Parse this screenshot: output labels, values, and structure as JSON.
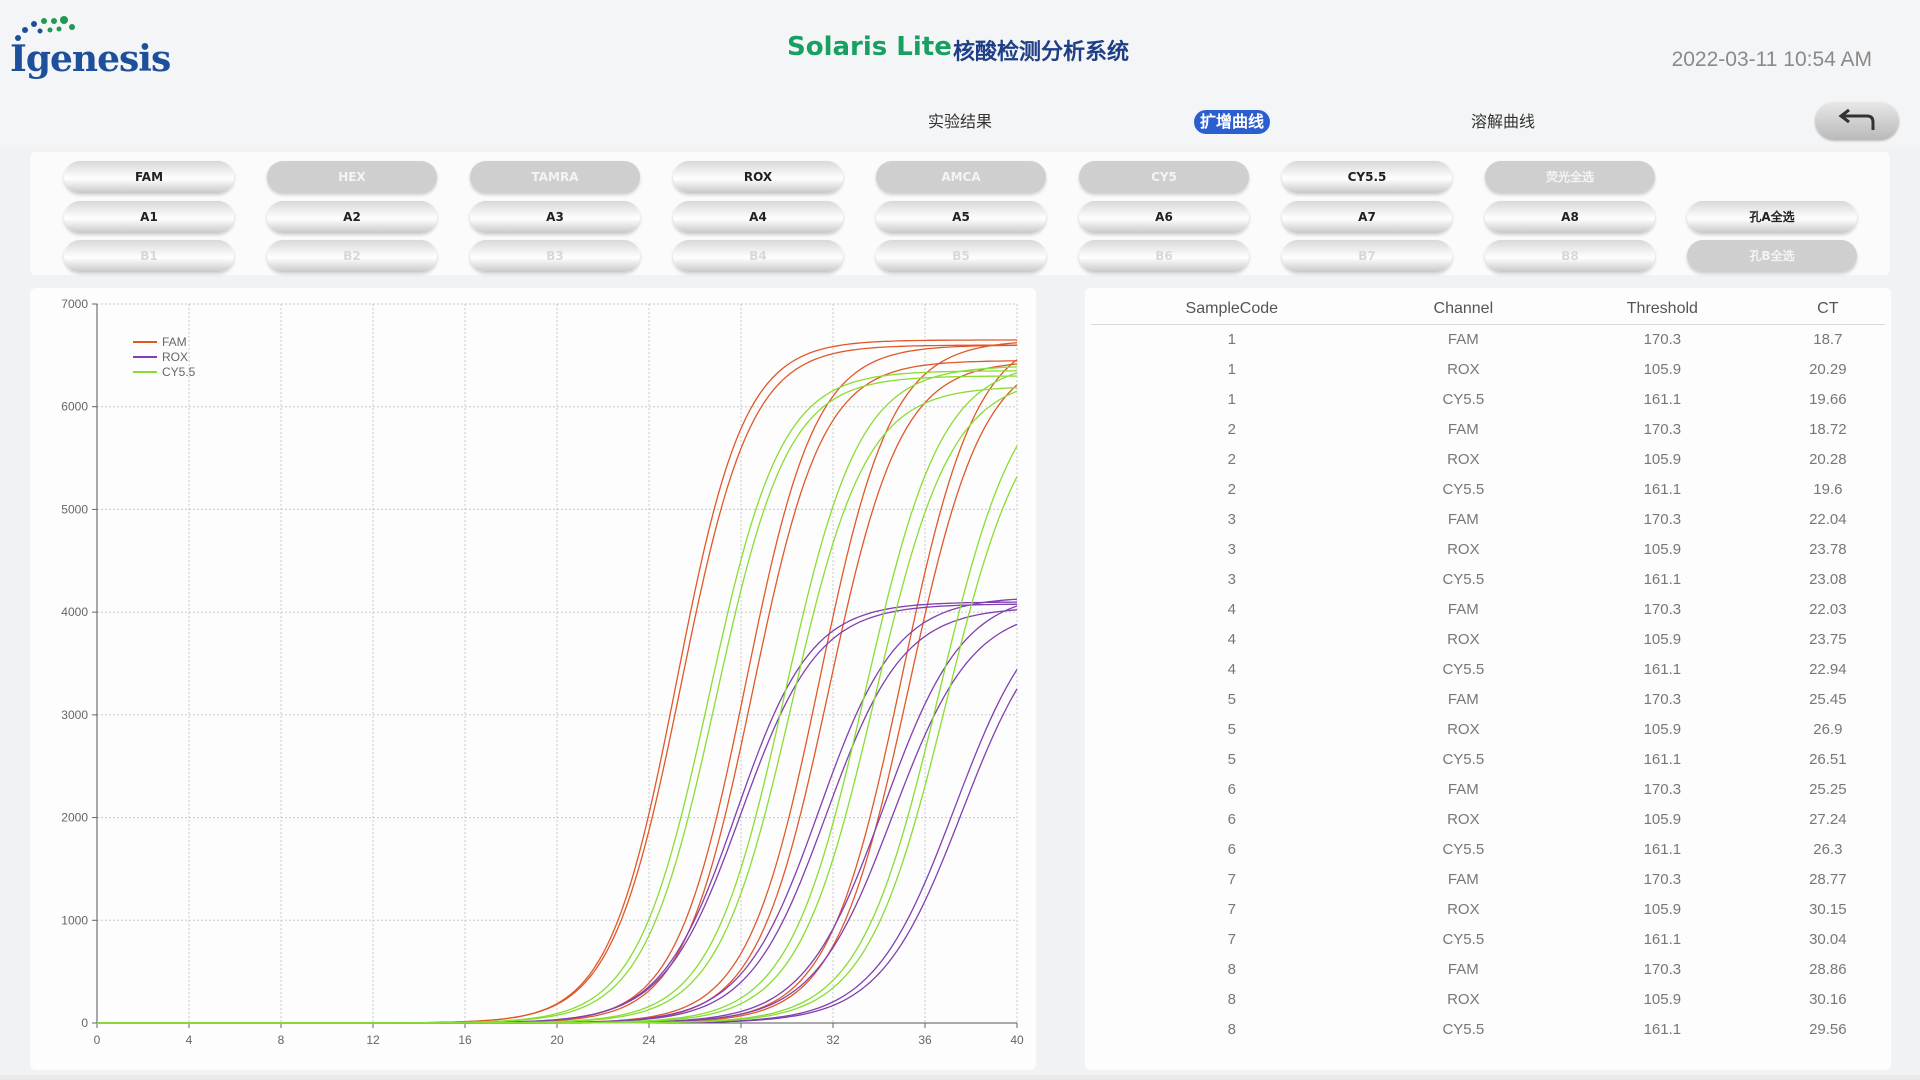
{
  "header": {
    "logo_text": "Igenesis",
    "title": "Solaris Lite",
    "subtitle": "核酸检测分析系统",
    "datetime": "2022-03-11 10:54 AM"
  },
  "nav": {
    "tabs": [
      {
        "label": "实验结果",
        "active": false
      },
      {
        "label": "扩增曲线",
        "active": true
      },
      {
        "label": "溶解曲线",
        "active": false
      }
    ]
  },
  "channels": [
    {
      "label": "FAM",
      "active": true
    },
    {
      "label": "HEX",
      "active": false
    },
    {
      "label": "TAMRA",
      "active": false
    },
    {
      "label": "ROX",
      "active": true
    },
    {
      "label": "AMCA",
      "active": false
    },
    {
      "label": "CY5",
      "active": false
    },
    {
      "label": "CY5.5",
      "active": true
    },
    {
      "label": "荧光全选",
      "active": false
    }
  ],
  "wells_a": [
    "A1",
    "A2",
    "A3",
    "A4",
    "A5",
    "A6",
    "A7",
    "A8"
  ],
  "wells_b": [
    "B1",
    "B2",
    "B3",
    "B4",
    "B5",
    "B6",
    "B7",
    "B8"
  ],
  "select_all_a": "孔A全选",
  "select_all_b": "孔B全选",
  "colors": {
    "FAM": "#e0582a",
    "ROX": "#8040b0",
    "CY5.5": "#88dd33",
    "accent": "#2b5fd0",
    "brand_green": "#17a062",
    "brand_blue": "#1f3e86"
  },
  "chart_data": {
    "type": "line",
    "xlim": [
      0,
      40
    ],
    "ylim": [
      0,
      7000
    ],
    "x_ticks": [
      0,
      4,
      8,
      12,
      16,
      20,
      24,
      28,
      32,
      36,
      40
    ],
    "y_ticks": [
      0,
      1000,
      2000,
      3000,
      4000,
      5000,
      6000,
      7000
    ],
    "grid": true,
    "legend": {
      "position": "top-left",
      "entries": [
        "FAM",
        "ROX",
        "CY5.5"
      ]
    },
    "series": [
      {
        "name": "FAM",
        "color": "#e0582a",
        "curves": [
          {
            "midpoint": 25.2,
            "slope": 0.68,
            "plateau": 6650
          },
          {
            "midpoint": 25.4,
            "slope": 0.66,
            "plateau": 6600
          },
          {
            "midpoint": 28.2,
            "slope": 0.66,
            "plateau": 6600
          },
          {
            "midpoint": 28.5,
            "slope": 0.66,
            "plateau": 6450
          },
          {
            "midpoint": 31.4,
            "slope": 0.64,
            "plateau": 6650
          },
          {
            "midpoint": 31.8,
            "slope": 0.64,
            "plateau": 6450
          },
          {
            "midpoint": 35.0,
            "slope": 0.62,
            "plateau": 6750
          },
          {
            "midpoint": 35.3,
            "slope": 0.62,
            "plateau": 6550
          }
        ]
      },
      {
        "name": "ROX",
        "color": "#8040b0",
        "curves": [
          {
            "midpoint": 27.8,
            "slope": 0.62,
            "plateau": 4100
          },
          {
            "midpoint": 28.0,
            "slope": 0.6,
            "plateau": 4080
          },
          {
            "midpoint": 31.4,
            "slope": 0.6,
            "plateau": 4150
          },
          {
            "midpoint": 31.7,
            "slope": 0.6,
            "plateau": 4050
          },
          {
            "midpoint": 34.2,
            "slope": 0.58,
            "plateau": 4200
          },
          {
            "midpoint": 34.6,
            "slope": 0.58,
            "plateau": 4050
          },
          {
            "midpoint": 37.3,
            "slope": 0.56,
            "plateau": 4200
          },
          {
            "midpoint": 37.6,
            "slope": 0.56,
            "plateau": 4100
          }
        ]
      },
      {
        "name": "CY5.5",
        "color": "#88dd33",
        "curves": [
          {
            "midpoint": 26.6,
            "slope": 0.64,
            "plateau": 6350
          },
          {
            "midpoint": 26.9,
            "slope": 0.64,
            "plateau": 6300
          },
          {
            "midpoint": 29.9,
            "slope": 0.62,
            "plateau": 6400
          },
          {
            "midpoint": 30.2,
            "slope": 0.62,
            "plateau": 6200
          },
          {
            "midpoint": 33.4,
            "slope": 0.6,
            "plateau": 6450
          },
          {
            "midpoint": 33.8,
            "slope": 0.6,
            "plateau": 6300
          },
          {
            "midpoint": 36.6,
            "slope": 0.58,
            "plateau": 6400
          },
          {
            "midpoint": 36.9,
            "slope": 0.58,
            "plateau": 6200
          }
        ]
      }
    ]
  },
  "table": {
    "headers": [
      "SampleCode",
      "Channel",
      "Threshold",
      "CT"
    ],
    "rows": [
      [
        "1",
        "FAM",
        "170.3",
        "18.7"
      ],
      [
        "1",
        "ROX",
        "105.9",
        "20.29"
      ],
      [
        "1",
        "CY5.5",
        "161.1",
        "19.66"
      ],
      [
        "2",
        "FAM",
        "170.3",
        "18.72"
      ],
      [
        "2",
        "ROX",
        "105.9",
        "20.28"
      ],
      [
        "2",
        "CY5.5",
        "161.1",
        "19.6"
      ],
      [
        "3",
        "FAM",
        "170.3",
        "22.04"
      ],
      [
        "3",
        "ROX",
        "105.9",
        "23.78"
      ],
      [
        "3",
        "CY5.5",
        "161.1",
        "23.08"
      ],
      [
        "4",
        "FAM",
        "170.3",
        "22.03"
      ],
      [
        "4",
        "ROX",
        "105.9",
        "23.75"
      ],
      [
        "4",
        "CY5.5",
        "161.1",
        "22.94"
      ],
      [
        "5",
        "FAM",
        "170.3",
        "25.45"
      ],
      [
        "5",
        "ROX",
        "105.9",
        "26.9"
      ],
      [
        "5",
        "CY5.5",
        "161.1",
        "26.51"
      ],
      [
        "6",
        "FAM",
        "170.3",
        "25.25"
      ],
      [
        "6",
        "ROX",
        "105.9",
        "27.24"
      ],
      [
        "6",
        "CY5.5",
        "161.1",
        "26.3"
      ],
      [
        "7",
        "FAM",
        "170.3",
        "28.77"
      ],
      [
        "7",
        "ROX",
        "105.9",
        "30.15"
      ],
      [
        "7",
        "CY5.5",
        "161.1",
        "30.04"
      ],
      [
        "8",
        "FAM",
        "170.3",
        "28.86"
      ],
      [
        "8",
        "ROX",
        "105.9",
        "30.16"
      ],
      [
        "8",
        "CY5.5",
        "161.1",
        "29.56"
      ]
    ]
  }
}
